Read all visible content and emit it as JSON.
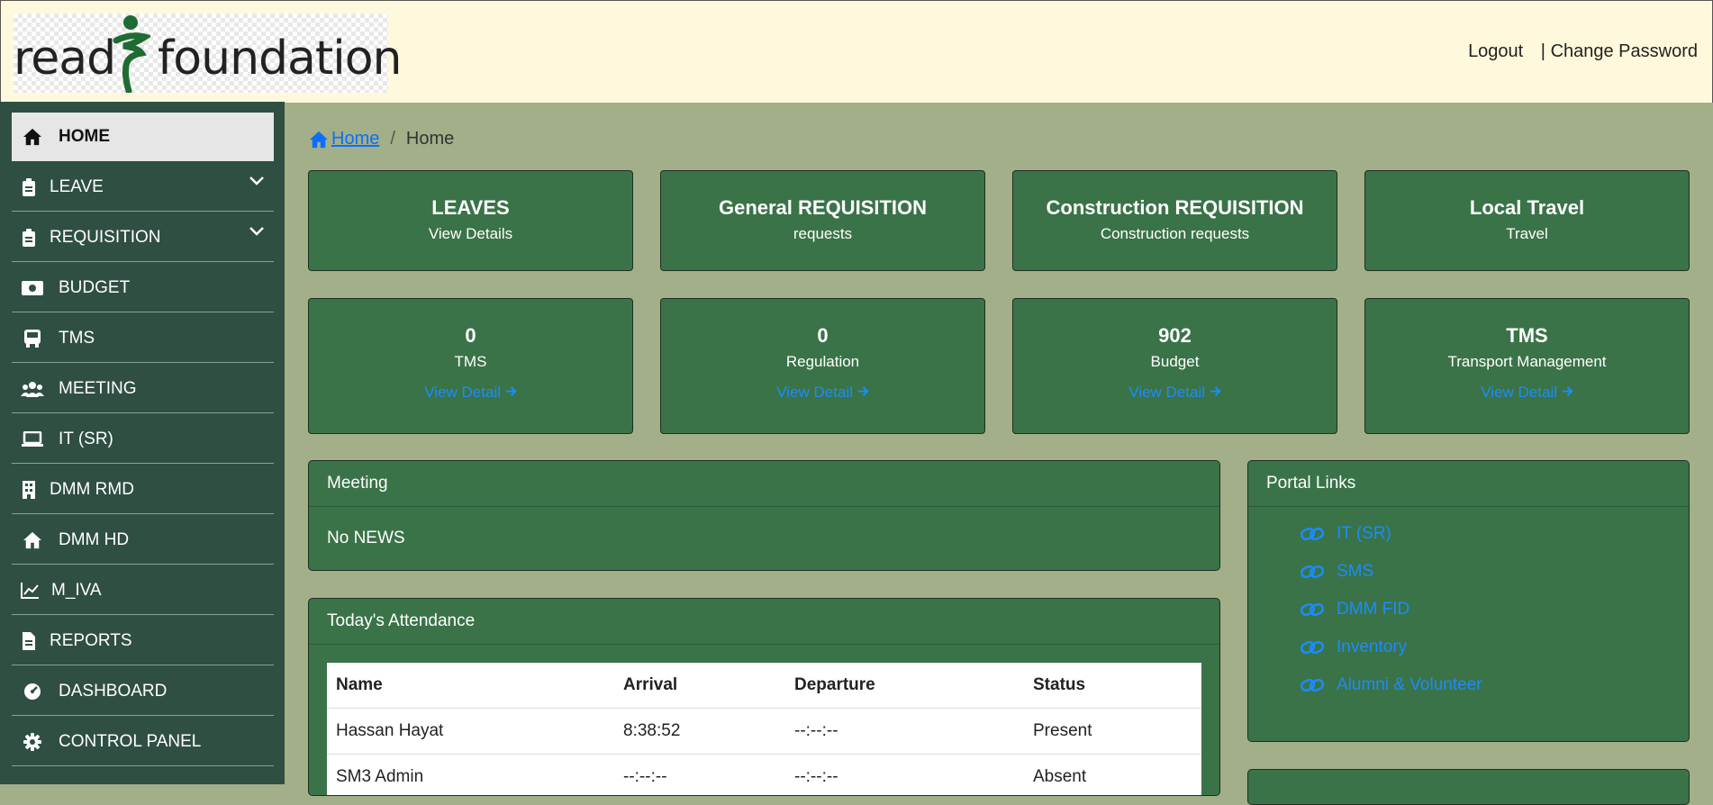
{
  "header": {
    "logo_left": "read",
    "logo_right": "foundation",
    "logout": "Logout",
    "separator": "|",
    "change_password": "Change Password"
  },
  "sidebar": {
    "items": [
      {
        "label": "HOME",
        "icon": "home-icon"
      },
      {
        "label": "LEAVE",
        "icon": "clipboard-icon"
      },
      {
        "label": "REQUISITION",
        "icon": "clipboard-icon"
      },
      {
        "label": "BUDGET",
        "icon": "money-icon"
      },
      {
        "label": "TMS",
        "icon": "bus-icon"
      },
      {
        "label": "MEETING",
        "icon": "users-icon"
      },
      {
        "label": "IT (SR)",
        "icon": "laptop-icon"
      },
      {
        "label": "DMM RMD",
        "icon": "building-icon"
      },
      {
        "label": "DMM HD",
        "icon": "home-icon"
      },
      {
        "label": "M_IVA",
        "icon": "chart-line-icon"
      },
      {
        "label": "REPORTS",
        "icon": "file-icon"
      },
      {
        "label": "DASHBOARD",
        "icon": "gauge-icon"
      },
      {
        "label": "CONTROL PANEL",
        "icon": "gear-icon"
      }
    ]
  },
  "breadcrumb": {
    "home_link": "Home",
    "divider": "/",
    "current": "Home"
  },
  "top_cards": [
    {
      "title": "LEAVES",
      "subtitle": "View Details"
    },
    {
      "title": "General REQUISITION",
      "subtitle": "requests"
    },
    {
      "title": "Construction REQUISITION",
      "subtitle": "Construction requests"
    },
    {
      "title": "Local Travel",
      "subtitle": "Travel"
    }
  ],
  "stat_cards": [
    {
      "value": "0",
      "label": "TMS",
      "link": "View Detail"
    },
    {
      "value": "0",
      "label": "Regulation",
      "link": "View Detail"
    },
    {
      "value": "902",
      "label": "Budget",
      "link": "View Detail"
    },
    {
      "value": "TMS",
      "label": "Transport Management",
      "link": "View Detail"
    }
  ],
  "meeting": {
    "title": "Meeting",
    "body": "No NEWS"
  },
  "attendance": {
    "title": "Today's Attendance",
    "columns": [
      "Name",
      "Arrival",
      "Departure",
      "Status"
    ],
    "rows": [
      [
        "Hassan Hayat",
        "8:38:52",
        "--:--:--",
        "Present"
      ],
      [
        "SM3 Admin",
        "--:--:--",
        "--:--:--",
        "Absent"
      ]
    ]
  },
  "portal_links": {
    "title": "Portal Links",
    "items": [
      "IT (SR)",
      "SMS",
      "DMM FID",
      "Inventory",
      "Alumni & Volunteer"
    ]
  },
  "colors": {
    "accent_green": "#3a7348",
    "link_blue": "#1a8cff",
    "sidebar_bg": "#2f4f43",
    "header_bg": "#fef9dc",
    "page_bg": "#a2af88"
  }
}
